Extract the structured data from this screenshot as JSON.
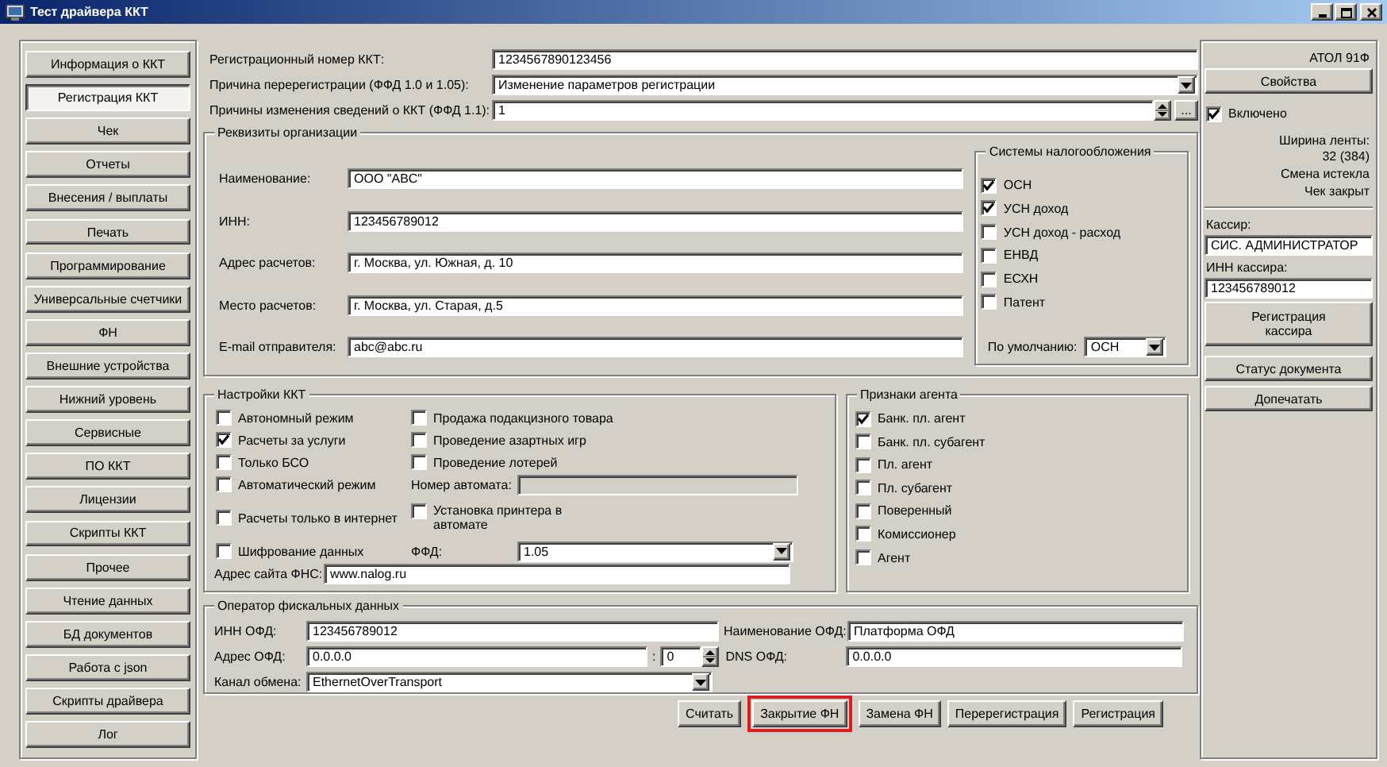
{
  "window": {
    "title": "Тест драйвера ККТ"
  },
  "sidebar": {
    "items": [
      {
        "label": "Информация о ККТ",
        "selected": false
      },
      {
        "label": "Регистрация ККТ",
        "selected": true
      },
      {
        "label": "Чек",
        "selected": false
      },
      {
        "label": "Отчеты",
        "selected": false
      },
      {
        "label": "Внесения / выплаты",
        "selected": false
      },
      {
        "label": "Печать",
        "selected": false
      },
      {
        "label": "Программирование",
        "selected": false
      },
      {
        "label": "Универсальные счетчики",
        "selected": false
      },
      {
        "label": "ФН",
        "selected": false
      },
      {
        "label": "Внешние устройства",
        "selected": false
      },
      {
        "label": "Нижний уровень",
        "selected": false
      },
      {
        "label": "Сервисные",
        "selected": false
      },
      {
        "label": "ПО ККТ",
        "selected": false
      },
      {
        "label": "Лицензии",
        "selected": false
      },
      {
        "label": "Скрипты ККТ",
        "selected": false
      },
      {
        "label": "Прочее",
        "selected": false
      },
      {
        "label": "Чтение данных",
        "selected": false
      },
      {
        "label": "БД документов",
        "selected": false
      },
      {
        "label": "Работа с json",
        "selected": false
      },
      {
        "label": "Скрипты драйвера",
        "selected": false
      },
      {
        "label": "Лог",
        "selected": false
      }
    ]
  },
  "registration": {
    "number": {
      "label": "Регистрационный номер ККТ:",
      "value": "1234567890123456"
    },
    "reason": {
      "label": "Причина перерегистрации (ФФД 1.0 и 1.05):",
      "value": "Изменение параметров регистрации"
    },
    "change_reasons": {
      "label": "Причины изменения сведений о ККТ (ФФД 1.1):",
      "value": "1",
      "button": "..."
    }
  },
  "organization": {
    "title": "Реквизиты организации",
    "fields": [
      {
        "label": "Наименование:",
        "value": "ООО \"ABC\""
      },
      {
        "label": "ИНН:",
        "value": "123456789012"
      },
      {
        "label": "Адрес расчетов:",
        "value": "г. Москва, ул. Южная, д. 10"
      },
      {
        "label": "Место расчетов:",
        "value": "г. Москва, ул. Старая, д.5"
      },
      {
        "label": "E-mail отправителя:",
        "value": "abc@abc.ru"
      }
    ]
  },
  "tax_systems": {
    "title": "Системы налогообложения",
    "items": [
      {
        "label": "ОСН",
        "checked": true
      },
      {
        "label": "УСН доход",
        "checked": true
      },
      {
        "label": "УСН доход - расход",
        "checked": false
      },
      {
        "label": "ЕНВД",
        "checked": false
      },
      {
        "label": "ЕСХН",
        "checked": false
      },
      {
        "label": "Патент",
        "checked": false
      }
    ],
    "default": {
      "label": "По умолчанию:",
      "value": "ОСН"
    }
  },
  "settings": {
    "title": "Настройки ККТ",
    "rows": [
      {
        "cells": [
          {
            "kind": "check",
            "label": "Автономный режим",
            "checked": false
          },
          {
            "kind": "check",
            "label": "Продажа подакцизного товара",
            "checked": false
          }
        ]
      },
      {
        "cells": [
          {
            "kind": "check",
            "label": "Расчеты за услуги",
            "checked": true
          },
          {
            "kind": "check",
            "label": "Проведение азартных игр",
            "checked": false
          }
        ]
      },
      {
        "cells": [
          {
            "kind": "check",
            "label": "Только БСО",
            "checked": false
          },
          {
            "kind": "check",
            "label": "Проведение лотерей",
            "checked": false
          }
        ]
      },
      {
        "cells": [
          {
            "kind": "check",
            "label": "Автоматический режим",
            "checked": false
          },
          {
            "kind": "field",
            "label": "Номер автомата:",
            "disabled": true
          }
        ]
      },
      {
        "cells": [
          {
            "kind": "check",
            "label": "Расчеты только в интернет",
            "checked": false
          },
          {
            "kind": "check",
            "label": "Установка принтера в автомате",
            "checked": false
          }
        ]
      },
      {
        "cells": [
          {
            "kind": "check",
            "label": "Шифрование данных",
            "checked": false
          },
          {
            "kind": "combo",
            "label": "ФФД:",
            "value": "1.05",
            "disabled": false
          }
        ]
      }
    ],
    "site": {
      "label": "Адрес сайта ФНС:",
      "value": "www.nalog.ru"
    }
  },
  "agent": {
    "title": "Признаки агента",
    "items": [
      {
        "label": "Банк. пл. агент",
        "checked": true
      },
      {
        "label": "Банк. пл. субагент",
        "checked": false
      },
      {
        "label": "Пл. агент",
        "checked": false
      },
      {
        "label": "Пл. субагент",
        "checked": false
      },
      {
        "label": "Поверенный",
        "checked": false
      },
      {
        "label": "Комиссионер",
        "checked": false
      },
      {
        "label": "Агент",
        "checked": false
      }
    ]
  },
  "ofd": {
    "title": "Оператор фискальных данных",
    "inn": {
      "label": "ИНН ОФД:",
      "value": "123456789012"
    },
    "name": {
      "label": "Наименование ОФД:",
      "value": "Платформа ОФД"
    },
    "address": {
      "label": "Адрес ОФД:",
      "value": "0.0.0.0"
    },
    "port": {
      "separator": ":",
      "value": "0"
    },
    "dns": {
      "label": "DNS ОФД:",
      "value": "0.0.0.0"
    },
    "channel": {
      "label": "Канал обмена:",
      "value": "EthernetOverTransport"
    }
  },
  "actions": [
    {
      "label": "Считать",
      "highlighted": false
    },
    {
      "label": "Закрытие ФН",
      "highlighted": true
    },
    {
      "label": "Замена ФН",
      "highlighted": false
    },
    {
      "label": "Перерегистрация",
      "highlighted": false
    },
    {
      "label": "Регистрация",
      "highlighted": false
    }
  ],
  "device": {
    "model": "АТОЛ 91Ф",
    "properties": "Свойства",
    "enabled": {
      "label": "Включено",
      "checked": true
    },
    "status": [
      "Ширина ленты:\n32 (384)",
      "Смена истекла",
      "Чек закрыт"
    ],
    "cashier": {
      "label": "Кассир:",
      "value": "СИС. АДМИНИСТРАТОР"
    },
    "cashier_inn": {
      "label": "ИНН кассира:",
      "value": "123456789012"
    },
    "buttons": [
      "Регистрация кассира",
      "Статус документа",
      "Допечатать"
    ]
  }
}
